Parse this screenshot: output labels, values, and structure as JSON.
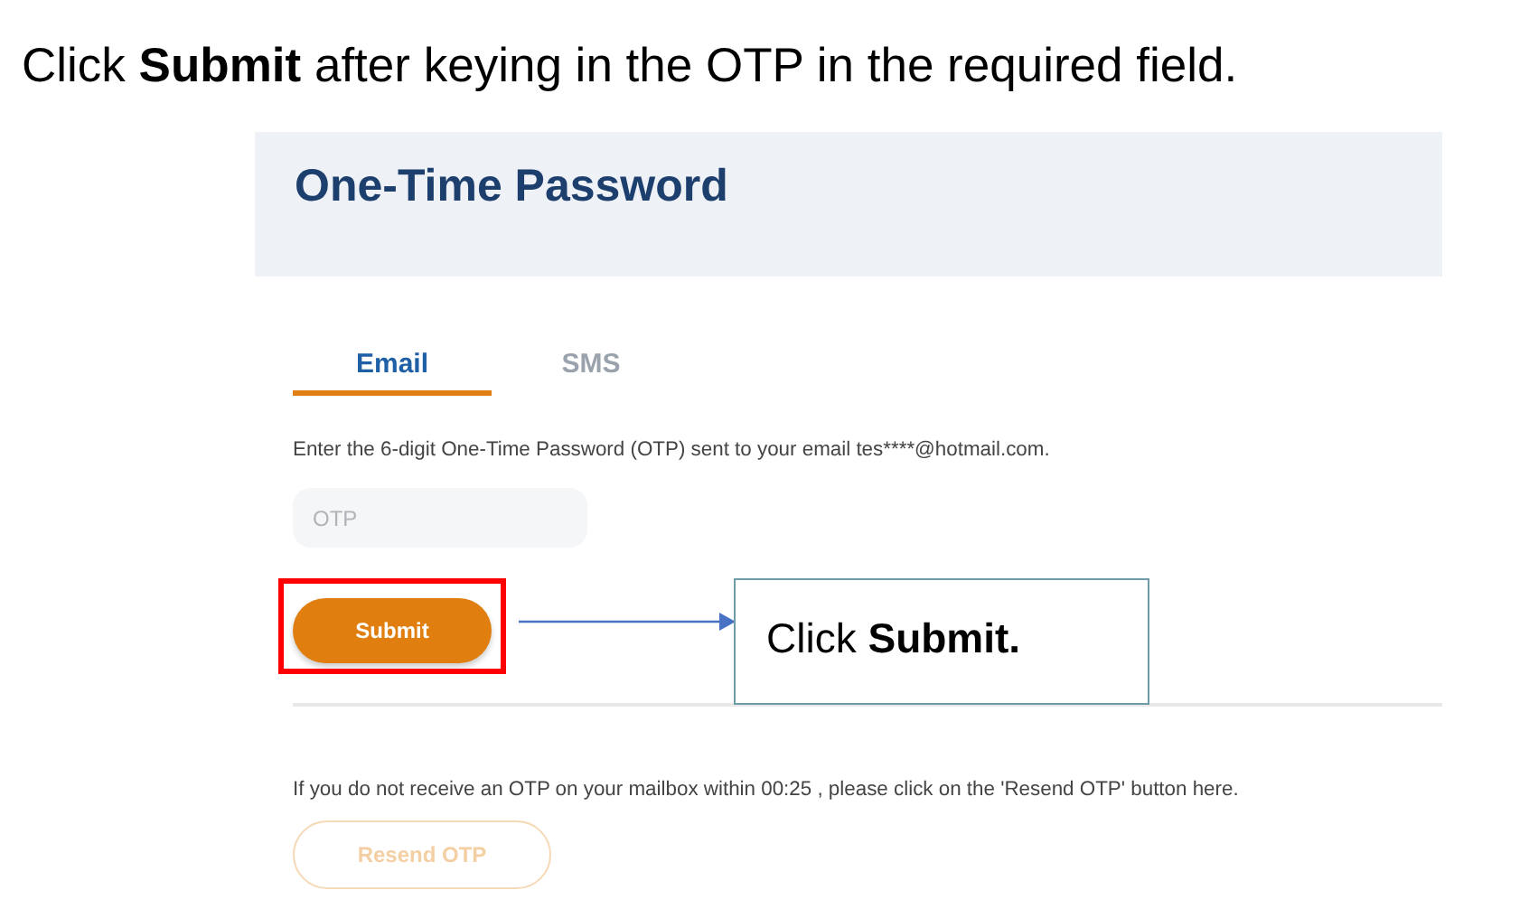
{
  "caption": "Click **Submit** after keying in the OTP in the required field.",
  "panel": {
    "title": "One-Time Password",
    "tabs": [
      {
        "label": "Email",
        "selected": true
      },
      {
        "label": "SMS",
        "selected": false
      }
    ],
    "instruction": "Enter the 6-digit One-Time Password (OTP) sent to your email tes****@hotmail.com.",
    "otp_field": {
      "placeholder": "OTP"
    },
    "submit_button": {
      "label": "Submit",
      "highlighted": true
    },
    "resend_note": "If you do not receive an OTP on your mailbox within 00:25 , please click on the 'Resend OTP' button here.",
    "resend_button": {
      "label": "Resend OTP",
      "disabled": true
    }
  },
  "callout": {
    "text": "Click **Submit.**"
  }
}
